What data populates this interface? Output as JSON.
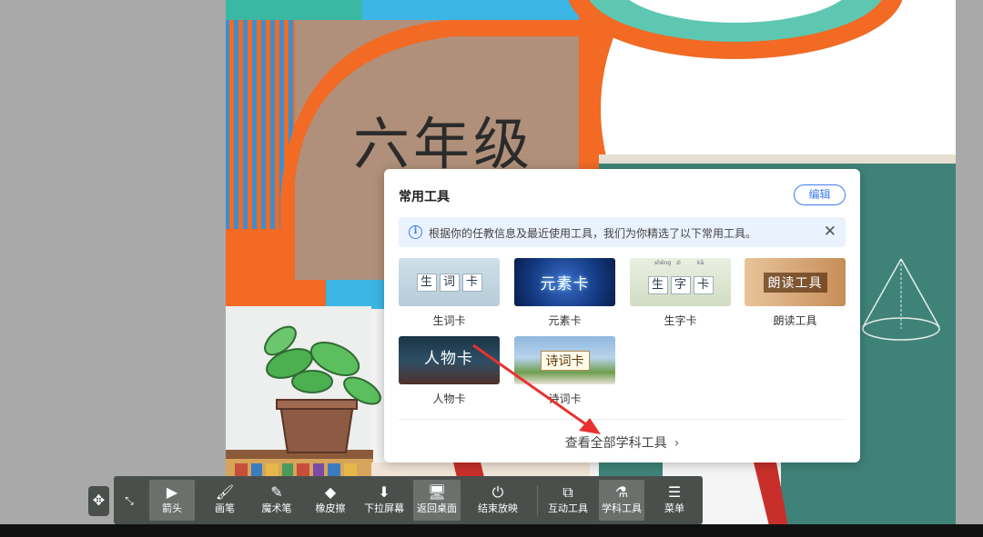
{
  "slide": {
    "title": "六年级"
  },
  "tools_panel": {
    "title": "常用工具",
    "edit_label": "编辑",
    "notice_text": "根据你的任教信息及最近使用工具，我们为你精选了以下常用工具。",
    "tools": [
      {
        "label": "生词卡",
        "thumb_chars": [
          "生",
          "词",
          "卡"
        ]
      },
      {
        "label": "元素卡",
        "thumb_text": "元素卡"
      },
      {
        "label": "生字卡",
        "thumb_chars": [
          "生",
          "字",
          "卡"
        ],
        "pinyin": [
          "shēng",
          "zì",
          "kǎ"
        ]
      },
      {
        "label": "朗读工具",
        "thumb_text": "朗读工具"
      },
      {
        "label": "人物卡",
        "thumb_text": "人物卡"
      },
      {
        "label": "诗词卡",
        "thumb_text": "诗词卡"
      }
    ],
    "view_all_label": "查看全部学科工具"
  },
  "toolbar": {
    "items": [
      {
        "label": "箭头",
        "icon": "pointer-arrow-icon",
        "active": true
      },
      {
        "label": "画笔",
        "icon": "brush-icon"
      },
      {
        "label": "魔术笔",
        "icon": "magic-pen-icon"
      },
      {
        "label": "橡皮擦",
        "icon": "eraser-icon"
      },
      {
        "label": "下拉屏幕",
        "icon": "pull-down-screen-icon"
      },
      {
        "label": "返回桌面",
        "icon": "desktop-icon",
        "active": true
      },
      {
        "label": "结束放映",
        "icon": "power-icon"
      },
      {
        "label": "互动工具",
        "icon": "interactive-tools-icon"
      },
      {
        "label": "学科工具",
        "icon": "subject-tools-icon",
        "active": true
      },
      {
        "label": "菜单",
        "icon": "menu-icon"
      }
    ]
  },
  "colors": {
    "accent": "#3d7cf0",
    "toolbar_bg": "#4a4f4c",
    "arrow": "#e8312f",
    "slide_orange": "#f26a24",
    "slide_tan": "#b0907a",
    "chalkboard": "#3f8378"
  }
}
